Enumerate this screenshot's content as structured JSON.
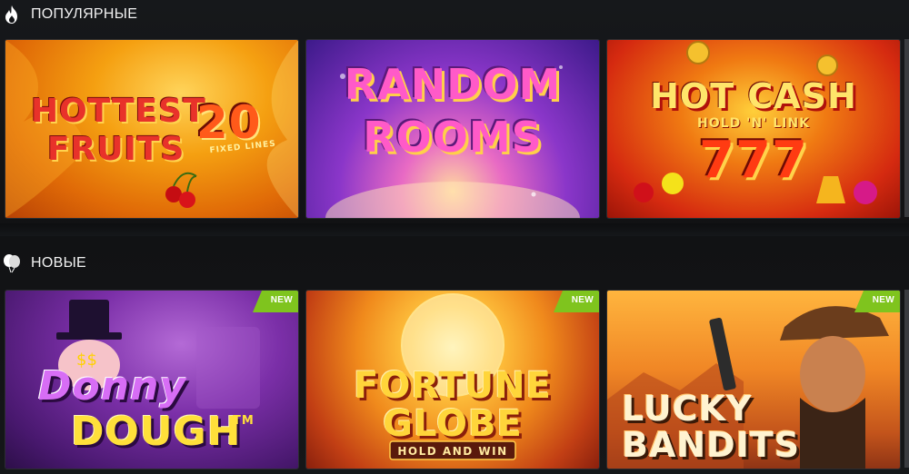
{
  "sections": [
    {
      "title": "ПОПУЛЯРНЫЕ",
      "icon": "fire-icon",
      "games": [
        {
          "title_lines": [
            "HOTTEST",
            "FRUITS",
            "20",
            "FIXED LINES"
          ],
          "badge": null
        },
        {
          "title_lines": [
            "RANDOM",
            "ROOMS"
          ],
          "badge": null
        },
        {
          "title_lines": [
            "HOT CASH",
            "HOLD 'N' LINK",
            "777"
          ],
          "badge": null
        }
      ]
    },
    {
      "title": "НОВЫЕ",
      "icon": "balloons-icon",
      "games": [
        {
          "title_lines": [
            "Donny",
            "DOUGH",
            "TM"
          ],
          "badge": "NEW"
        },
        {
          "title_lines": [
            "FORTUNE",
            "GLOBE",
            "HOLD AND WIN"
          ],
          "badge": "NEW"
        },
        {
          "title_lines": [
            "LUCKY",
            "BANDITS"
          ],
          "badge": "NEW"
        }
      ]
    }
  ],
  "colors": {
    "badge_green": "#7fc41e",
    "background": "#141518",
    "tile_border": "#2b2d31"
  }
}
